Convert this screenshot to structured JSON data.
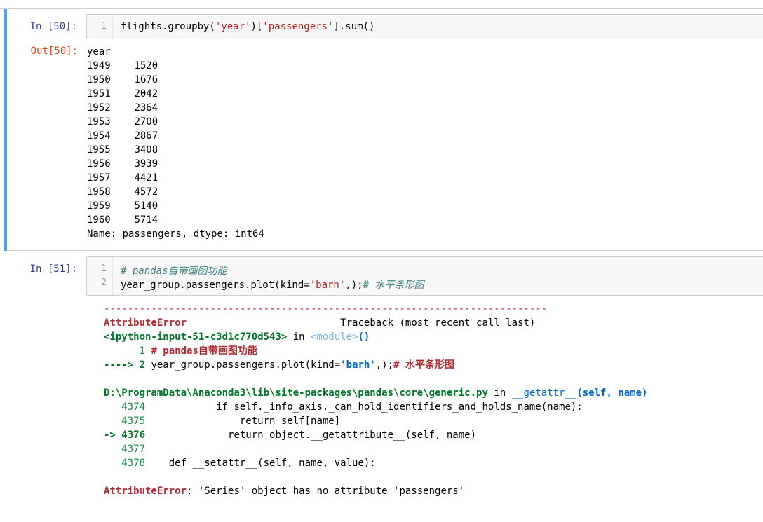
{
  "cells": {
    "c50": {
      "in_prompt": "In  [50]:",
      "line_num": "1",
      "code_prefix": "flights.groupby(",
      "code_str1": "'year'",
      "code_mid": ")[",
      "code_str2": "'passengers'",
      "code_suffix": "].sum()",
      "out_prompt": "Out[50]:",
      "output_header": "year",
      "rows": [
        {
          "year": "1949",
          "value": "1520"
        },
        {
          "year": "1950",
          "value": "1676"
        },
        {
          "year": "1951",
          "value": "2042"
        },
        {
          "year": "1952",
          "value": "2364"
        },
        {
          "year": "1953",
          "value": "2700"
        },
        {
          "year": "1954",
          "value": "2867"
        },
        {
          "year": "1955",
          "value": "3408"
        },
        {
          "year": "1956",
          "value": "3939"
        },
        {
          "year": "1957",
          "value": "4421"
        },
        {
          "year": "1958",
          "value": "4572"
        },
        {
          "year": "1959",
          "value": "5140"
        },
        {
          "year": "1960",
          "value": "5714"
        }
      ],
      "output_footer": "Name: passengers, dtype: int64"
    },
    "c51": {
      "in_prompt": "In  [51]:",
      "line1_num": "1",
      "line1_comment": "# pandas自带画图功能",
      "line2_num": "2",
      "line2_prefix": "year_group.passengers.plot(kind=",
      "line2_str": "'barh'",
      "line2_mid": ",);",
      "line2_comment": "# 水平条形图",
      "tb": {
        "dashes": "---------------------------------------------------------------------------",
        "err_name": "AttributeError",
        "traceback_label": "Traceback (most recent call last)",
        "input_ref": "<ipython-input-51-c3d1c770d543>",
        "in_word": " in ",
        "module_ref": "<module>",
        "parens": "()",
        "l1_num": "      1 ",
        "l1_text": "# pandas自带画图功能",
        "l2_arrow": "----> 2 ",
        "l2_prefix": "year_group.passengers.plot(kind=",
        "l2_str": "'barh'",
        "l2_mid": ",);",
        "l2_comment": "# 水平条形图",
        "file_path": "D:\\ProgramData\\Anaconda3\\lib\\site-packages\\pandas\\core\\generic.py",
        "file_in": " in ",
        "func_name": "__getattr__",
        "func_args_open": "(",
        "func_self": "self",
        "func_comma": ", ",
        "func_name_arg": "name",
        "func_args_close": ")",
        "src_lines": [
          {
            "num": "   4374",
            "code": "            if self._info_axis._can_hold_identifiers_and_holds_name(name):"
          },
          {
            "num": "   4375",
            "code": "                return self[name]"
          },
          {
            "num": "-> 4376",
            "code": "              return object.__getattribute__(self, name)"
          },
          {
            "num": "   4377",
            "code": ""
          },
          {
            "num": "   4378",
            "code": "    def __setattr__(self, name, value):"
          }
        ],
        "final_err": "AttributeError",
        "final_msg": ": 'Series' object has no attribute 'passengers'"
      }
    }
  }
}
